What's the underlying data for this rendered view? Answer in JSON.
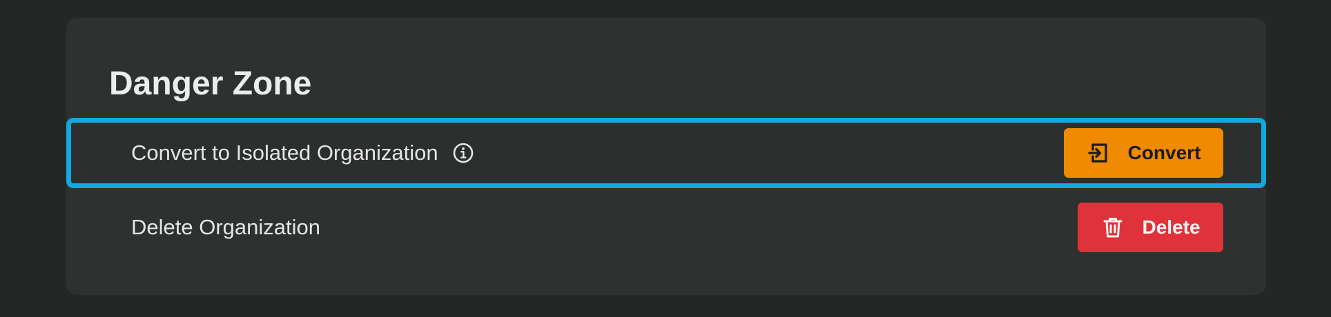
{
  "section": {
    "title": "Danger Zone"
  },
  "rows": [
    {
      "label": "Convert to Isolated Organization",
      "info_icon": "info-circle-icon",
      "button": {
        "label": "Convert",
        "icon": "enter-door-icon",
        "color": "#f08a00"
      },
      "highlighted": true,
      "highlight_color": "#12a9de"
    },
    {
      "label": "Delete Organization",
      "button": {
        "label": "Delete",
        "icon": "trash-icon",
        "color": "#e0323a"
      },
      "highlighted": false
    }
  ]
}
